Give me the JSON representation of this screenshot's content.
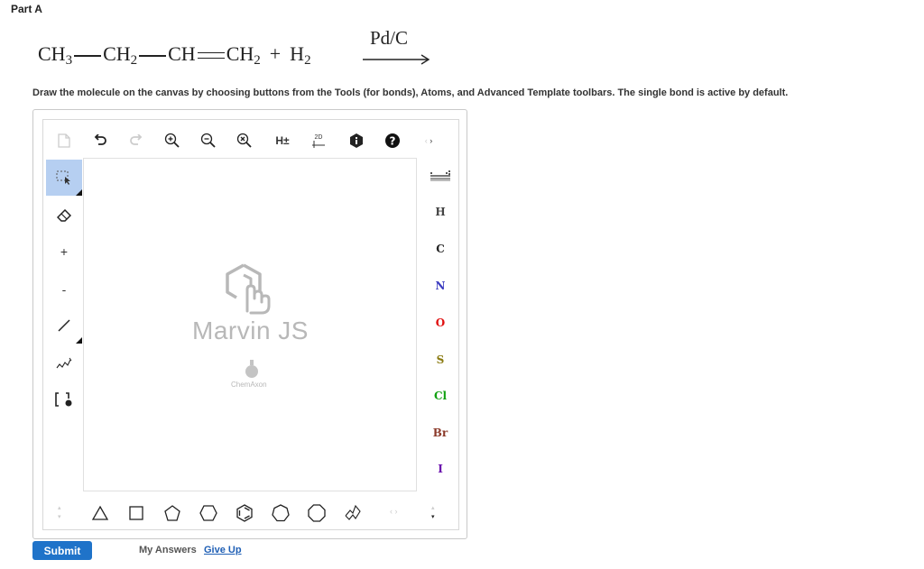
{
  "part": {
    "title": "Part A"
  },
  "equation": {
    "ch3": "CH",
    "ch3_sub": "3",
    "ch2": "CH",
    "ch2_sub": "2",
    "ch": "CH",
    "ch2b": "CH",
    "ch2b_sub": "2",
    "plus": "+",
    "h2": "H",
    "h2_sub": "2",
    "catalyst": "Pd/C"
  },
  "instructions": "Draw the molecule on the canvas by choosing buttons from the Tools (for bonds), Atoms, and Advanced Template toolbars. The single bond is active by default.",
  "toolbar": {
    "h_toggle": "H±",
    "clean2d": "2D",
    "icons": [
      "new-document-icon",
      "undo-icon",
      "redo-icon",
      "zoom-in-icon",
      "zoom-out-icon",
      "zoom-reset-icon",
      "implicit-hydrogens-icon",
      "clean-2d-icon",
      "info-icon",
      "help-icon",
      "scroll-arrows-icon"
    ]
  },
  "left_tools": {
    "plus": "+",
    "minus": "-",
    "icons": [
      "rectangle-select-icon",
      "eraser-icon",
      "charge-plus-icon",
      "charge-minus-icon",
      "single-bond-icon",
      "chain-icon",
      "s-group-bracket-icon"
    ]
  },
  "canvas": {
    "watermark": "Marvin JS",
    "brand": "ChemAxon"
  },
  "atoms": {
    "H": {
      "label": "H",
      "color": "#444444"
    },
    "C": {
      "label": "C",
      "color": "#222222"
    },
    "N": {
      "label": "N",
      "color": "#3b3bc0"
    },
    "O": {
      "label": "O",
      "color": "#e01010"
    },
    "S": {
      "label": "S",
      "color": "#8a7a10"
    },
    "Cl": {
      "label": "Cl",
      "color": "#10a010"
    },
    "Br": {
      "label": "Br",
      "color": "#8b3a2a"
    },
    "I": {
      "label": "I",
      "color": "#6a0dad"
    }
  },
  "templates": [
    "cyclopropane",
    "cyclobutane",
    "cyclopentane",
    "cyclohexane",
    "benzene",
    "cycloheptane",
    "cyclooctane",
    "chair-cyclohexane"
  ],
  "actions": {
    "submit": "Submit",
    "my_answers": "My Answers",
    "give_up": "Give Up"
  }
}
